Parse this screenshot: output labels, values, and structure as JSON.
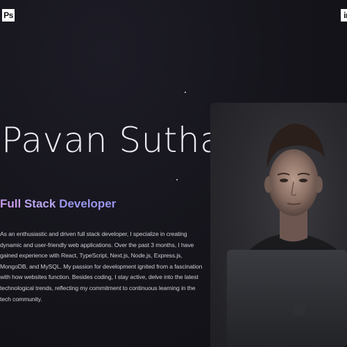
{
  "header": {
    "left_logo": {
      "text": "Ps",
      "icon": "photoshop-logo-icon"
    },
    "right_logo": {
      "text": "in",
      "icon": "linkedin-logo-icon"
    }
  },
  "hero": {
    "name": "Pavan Suthar",
    "role": {
      "part1": "Full",
      "part2": "Stack",
      "part3": "Developer"
    },
    "bio": "As an enthusiastic and driven full stack developer, I specialize in creating dynamic and user-friendly web applications. Over the past 3 months, I have gained experience with React, TypeScript, Next.js, Node.js, Express.js, MongoDB, and MySQL. My passion for development ignited from a fascination with how websites function. Besides coding, I stay active, delve into the latest technological trends, reflecting my commitment to continuous learning in the tech community."
  },
  "colors": {
    "background": "#131219",
    "role_gradient_start": "#c79be8",
    "role_gradient_end": "#9a96ee"
  },
  "profile_photo": {
    "icon": "profile-photo"
  }
}
